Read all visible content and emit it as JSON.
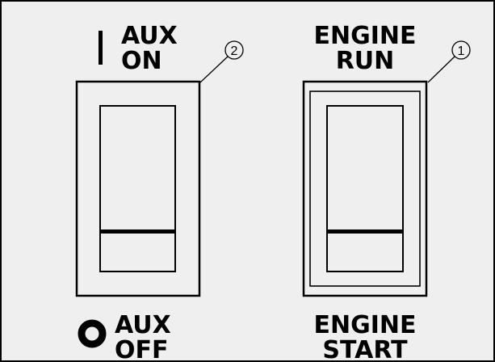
{
  "colors": {
    "background": "#efefef",
    "ink": "#000000"
  },
  "aux_switch": {
    "callout": "2",
    "top_label": [
      "AUX",
      "ON"
    ],
    "bottom_label": [
      "AUX",
      "OFF"
    ],
    "on_symbol": "bar-icon",
    "off_symbol": "circle-icon",
    "position": "off"
  },
  "engine_switch": {
    "callout": "1",
    "top_label": [
      "ENGINE",
      "RUN"
    ],
    "bottom_label": [
      "ENGINE",
      "START"
    ],
    "position": "run"
  }
}
